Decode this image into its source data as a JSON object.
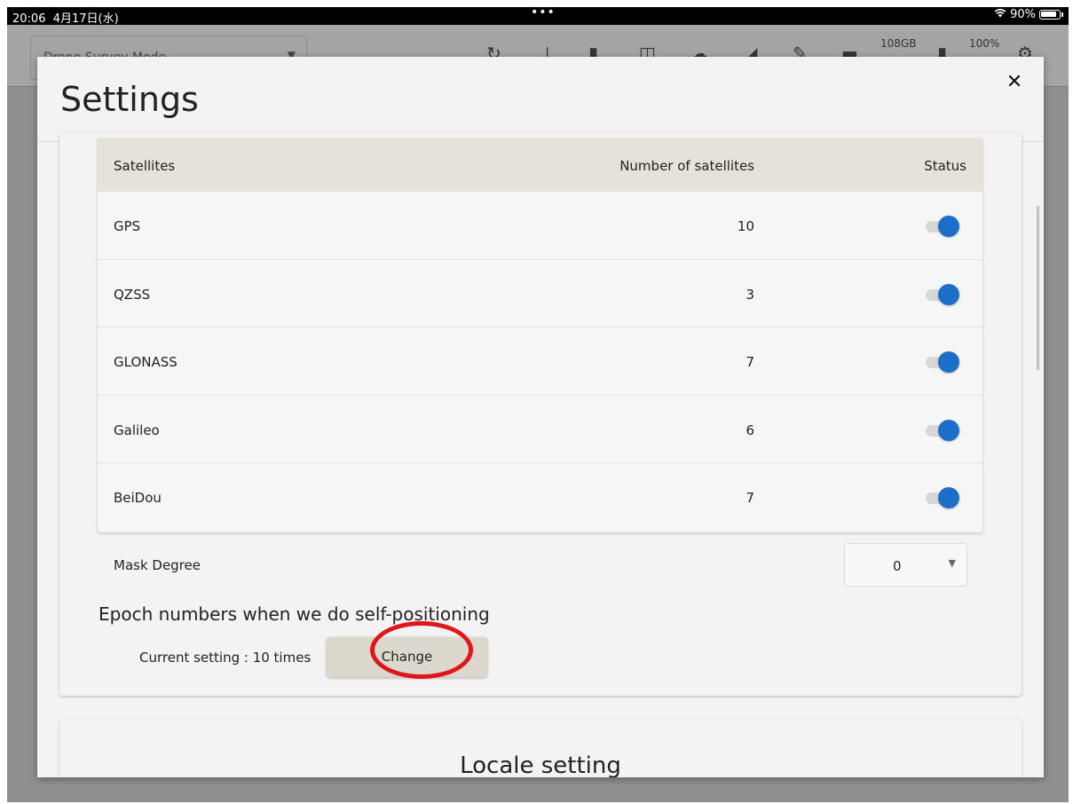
{
  "status_bar": {
    "time": "20:06",
    "date": "4月17日(水)",
    "dots": "•••",
    "battery": "90%"
  },
  "background_app": {
    "mode_select": "Drone Survey Mode",
    "storage": "108GB",
    "battery": "100%"
  },
  "modal": {
    "title": "Settings",
    "close_label": "✕"
  },
  "satellites_table": {
    "headers": {
      "name": "Satellites",
      "count": "Number of satellites",
      "status": "Status"
    },
    "rows": [
      {
        "name": "GPS",
        "count": "10",
        "status": true
      },
      {
        "name": "QZSS",
        "count": "3",
        "status": true
      },
      {
        "name": "GLONASS",
        "count": "7",
        "status": true
      },
      {
        "name": "Galileo",
        "count": "6",
        "status": true
      },
      {
        "name": "BeiDou",
        "count": "7",
        "status": true
      }
    ]
  },
  "mask_degree": {
    "label": "Mask Degree",
    "value": "0"
  },
  "epoch": {
    "title": "Epoch numbers when we do self-positioning",
    "current_setting": "Current setting : 10 times",
    "change_label": "Change"
  },
  "locale": {
    "title": "Locale setting"
  },
  "colors": {
    "toggle_on": "#1b6fc8",
    "header_bg": "#e5e2da",
    "highlight": "#e0161a"
  }
}
